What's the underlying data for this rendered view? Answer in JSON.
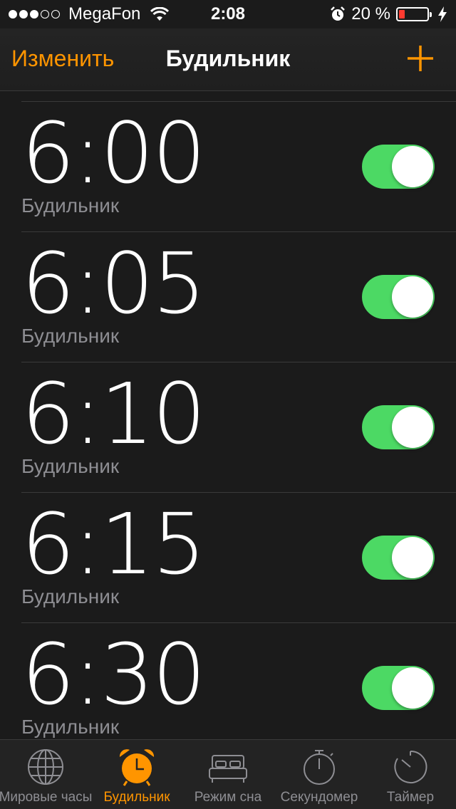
{
  "status_bar": {
    "carrier": "MegaFon",
    "time": "2:08",
    "battery_percent": "20 %",
    "battery_level": 0.2,
    "icons": [
      "signal-dots-icon",
      "wifi-icon",
      "alarm-clock-icon",
      "battery-icon",
      "charging-bolt-icon"
    ]
  },
  "nav": {
    "edit_label": "Изменить",
    "title": "Будильник",
    "add_icon": "plus-icon"
  },
  "alarms": [
    {
      "time": "6:00",
      "label": "Будильник",
      "enabled": true
    },
    {
      "time": "6:05",
      "label": "Будильник",
      "enabled": true
    },
    {
      "time": "6:10",
      "label": "Будильник",
      "enabled": true
    },
    {
      "time": "6:15",
      "label": "Будильник",
      "enabled": true
    },
    {
      "time": "6:30",
      "label": "Будильник",
      "enabled": true
    }
  ],
  "tabs": [
    {
      "label": "Мировые часы",
      "icon": "globe-icon",
      "active": false
    },
    {
      "label": "Будильник",
      "icon": "alarm-clock-icon",
      "active": true
    },
    {
      "label": "Режим сна",
      "icon": "bed-icon",
      "active": false
    },
    {
      "label": "Секундомер",
      "icon": "stopwatch-icon",
      "active": false
    },
    {
      "label": "Таймер",
      "icon": "timer-icon",
      "active": false
    }
  ],
  "colors": {
    "accent": "#ff9500",
    "toggle_on": "#4cd964",
    "background": "#1b1b1b",
    "secondary_text": "#8e8e93"
  }
}
